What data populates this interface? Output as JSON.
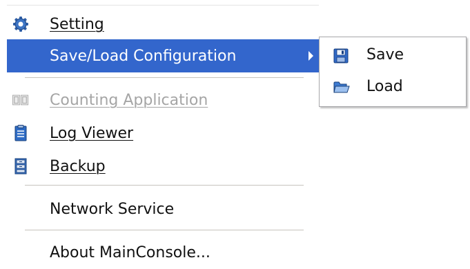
{
  "menu": {
    "items": [
      {
        "label": "Setting",
        "icon": "gear-icon"
      },
      {
        "label": "Save/Load Configuration",
        "highlighted": true,
        "has_submenu": true
      },
      {
        "label": "Counting Application",
        "icon": "counter-icon",
        "disabled": true
      },
      {
        "label": "Log Viewer",
        "icon": "log-viewer-icon"
      },
      {
        "label": "Backup",
        "icon": "backup-icon"
      },
      {
        "label": "Network Service"
      },
      {
        "label": "About MainConsole..."
      }
    ]
  },
  "submenu": {
    "items": [
      {
        "label": "Save",
        "icon": "floppy-disk-icon"
      },
      {
        "label": "Load",
        "icon": "folder-open-icon"
      }
    ]
  },
  "colors": {
    "highlight": "#3366cc",
    "disabled_text": "#a5a5a5",
    "separator": "#c6c3bd"
  }
}
